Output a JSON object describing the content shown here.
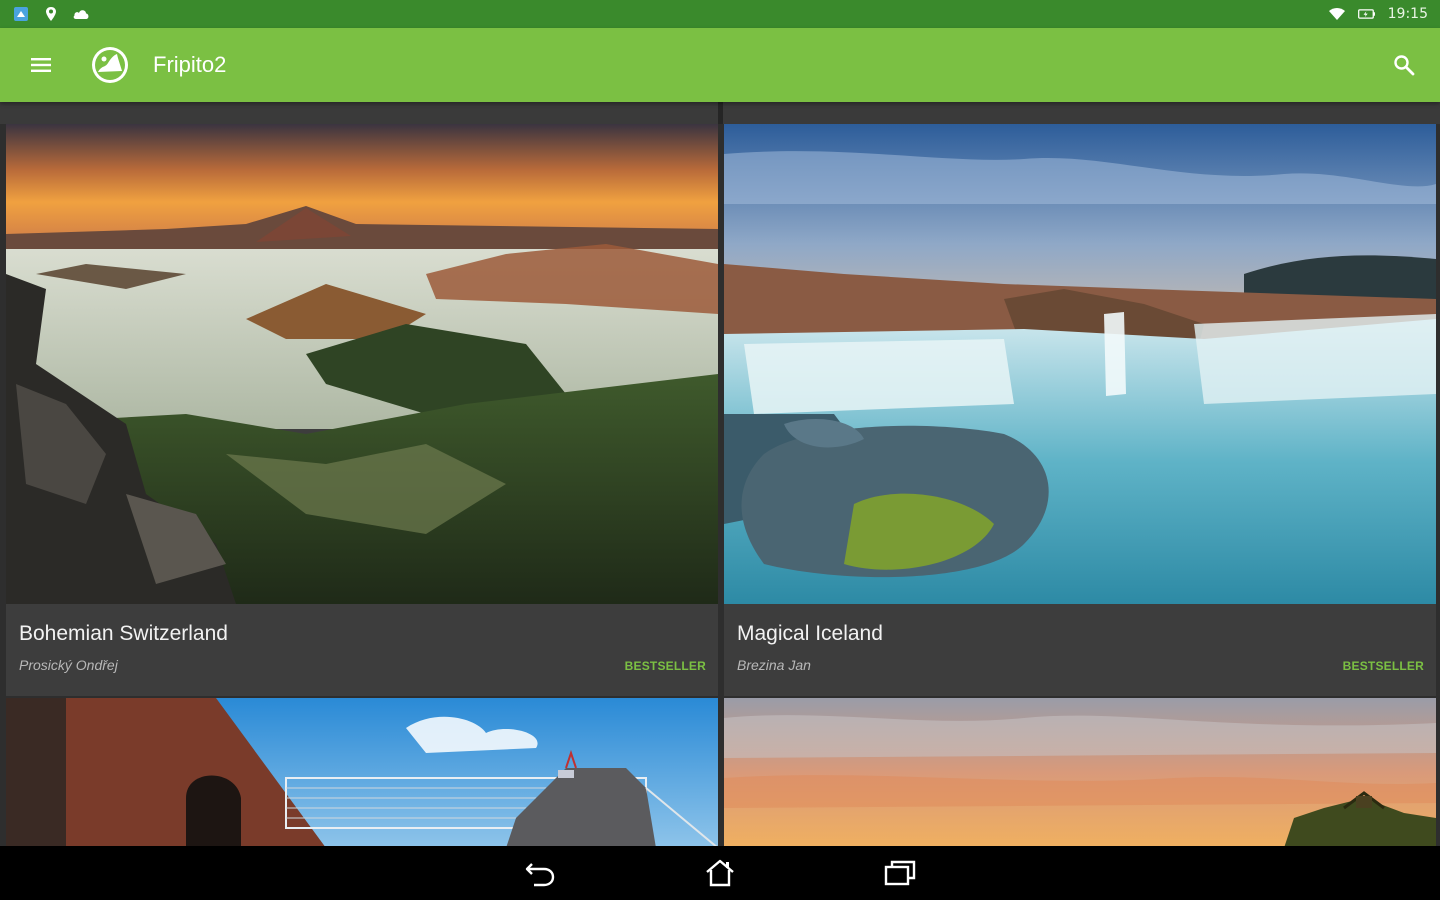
{
  "status_bar": {
    "time": "19:15",
    "icons_left": [
      "app-notification-icon",
      "location-icon",
      "cloud-icon"
    ],
    "icons_right": [
      "wifi-icon",
      "battery-charging-icon"
    ]
  },
  "app_bar": {
    "title": "Fripito2",
    "logo": "fripito-logo",
    "menu_icon": "hamburger-menu-icon",
    "search_icon": "search-icon",
    "color": "#7bc043"
  },
  "cards": [
    {
      "title": "Bohemian Switzerland",
      "author": "Prosický Ondřej",
      "badge": "BESTSELLER"
    },
    {
      "title": "Magical Iceland",
      "author": "Brezina Jan",
      "badge": "BESTSELLER"
    }
  ],
  "nav_bar": {
    "buttons": [
      "back-icon",
      "home-icon",
      "recent-apps-icon"
    ]
  },
  "colors": {
    "status_bar": "#3a8a2c",
    "app_bar": "#7bc043",
    "badge": "#7bc043",
    "card_bg": "#3d3d3d"
  }
}
